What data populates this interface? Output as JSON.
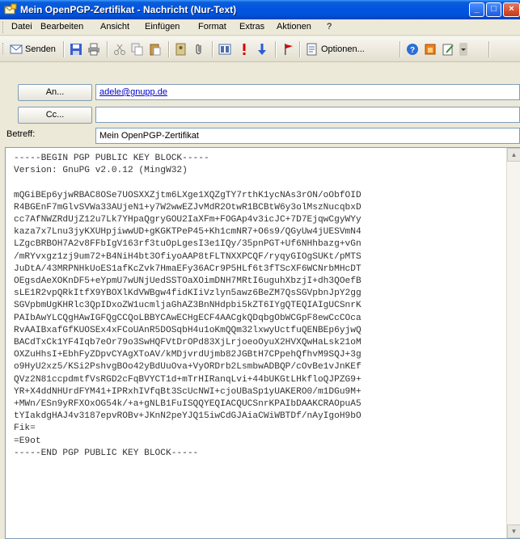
{
  "window": {
    "title": "Mein OpenPGP-Zertifikat - Nachricht (Nur-Text)",
    "minimize": "_",
    "maximize": "□",
    "close": "×"
  },
  "menu": {
    "items": [
      {
        "label": "Datei"
      },
      {
        "label": "Bearbeiten"
      },
      {
        "label": "Ansicht"
      },
      {
        "label": "Einfügen"
      },
      {
        "label": "Format"
      },
      {
        "label": "Extras"
      },
      {
        "label": "Aktionen"
      },
      {
        "label": "?"
      }
    ]
  },
  "toolbar": {
    "send_label": "Senden",
    "options_label": "Optionen...",
    "icons": [
      "save-icon",
      "print-icon",
      "cut-icon",
      "copy-icon",
      "paste-icon",
      "address-book-icon",
      "attach-icon",
      "insert-item-icon",
      "importance-high-icon",
      "importance-low-icon",
      "flag-icon",
      "options-icon",
      "help-icon",
      "pgp-encrypt-icon",
      "pgp-sign-icon"
    ]
  },
  "header": {
    "to_button": "An...",
    "to_value": "adele@gnupp.de",
    "cc_button": "Cc...",
    "cc_value": "",
    "subject_label": "Betreff:",
    "subject_value": "Mein OpenPGP-Zertifikat"
  },
  "body": {
    "text": "-----BEGIN PGP PUBLIC KEY BLOCK-----\nVersion: GnuPG v2.0.12 (MingW32)\n\nmQGiBEp6yjwRBAC8OSe7UOSXXZjtm6LXge1XQZgTY7rthK1ycNAs3rON/oObfOID\nR4BGEnF7mGlvSVWa33AUjeN1+y7W2wwEZJvMdR2OtwR1BCBtW6y3olMszNucqbxD\ncc7AfNWZRdUjZ12u7Lk7YHpaQgryGOU2IaXFm+FOGAp4v3icJC+7D7EjqwCgyWYy\nkaza7x7Lnu3jyKXUHpjiwwUD+gKGKTPeP45+Kh1cmNR7+O6s9/QGyUw4jUESVmN4\nLZgcBRBOH7A2v8FFbIgV163rf3tuOpLgesI3e1IQy/35pnPGT+Uf6NHhbazg+vGn\n/mRYvxgz1zj9um72+B4NiH4bt3OfiyoAAP8tFLTNXXPCQF/ryqyGIOgSUKt/pMTS\nJuDtA/43MRPNHkUoES1afKcZvk7HmaEFy36ACr9P5HLf6t3fTScXF6WCNrbMHcDT\nOEgsdAeXOKnDF5+eYpmU7wUNjUedSSTOaXOimDNH7MRtI6uguhXbzjI+dh3QOefB\nsLE1R2vpQRkItfX9YBOXlKdVWBgw4fidKIiVzlyn5awz6BeZM7QsSGVpbnJpY2gg\nSGVpbmUgKHRlc3QpIDxoZW1ucmljaGhAZ3BnNHdpbi5kZT6IYgQTEQIAIgUCSnrK\nPAIbAwYLCQgHAwIGFQgCCQoLBBYCAwECHgECF4AACgkQDqbgObWCGpF8ewCcCOca\nRvAAIBxafGfKUOSEx4xFCoUAnR5DOSqbH4u1oKmQQm32lxwyUctfuQENBEp6yjwQ\nBACdTxCk1YF4Iqb7eOr79o3SwHQFVtDrOPd83XjLrjoeoOyuX2HVXQwHaLsk21oM\nOXZuHhsI+EbhFyZDpvCYAgXToAV/kMDjvrdUjmb82JGBtH7CPpehQfhvM9SQJ+3g\no9HyU2xz5/KSi2PshvgBOo42yBdUuOva+VyORDrb2LsmbwADBQP/cOvBe1vJnKEf\nQVz2N81ccpdmtfVsRGD2cFqBVYCT1d+mTrHIRanqLvi+44bUKGtLHkfloQJPZG9+\nYR+X4ddNHUrdFYM41+IPRxhIVfqBt3ScUcNWI+cjoUBaSp1yUAKERO0/m1DGu9M+\n+MWn/ESn9yRFXOxOG54k/+a+gNLB1FuISQQYEQIACQUCSnrKPAIbDAAKCRAOpuA5\ntYIakdgHAJ4v3187epvROBv+JKnN2peYJQ15iwCdGJAiaCWiWBTDf/nAyIgoH9bO\nFik=\n=E9ot\n-----END PGP PUBLIC KEY BLOCK-----"
  }
}
